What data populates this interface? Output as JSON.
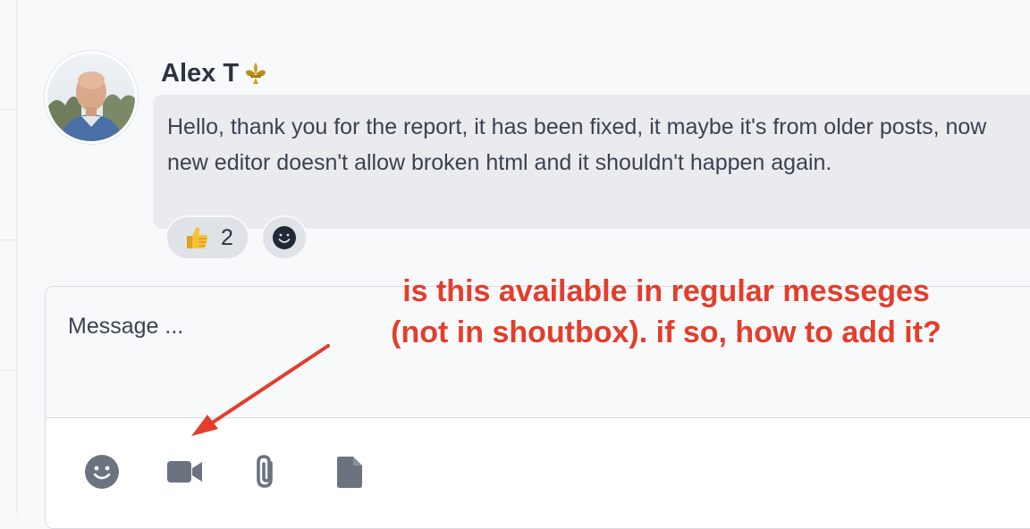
{
  "message": {
    "author": "Alex T",
    "author_badge_icon": "fleur-de-lis-icon",
    "text": "Hello, thank you for the report, it has been fixed, it maybe it's from older posts, now new editor doesn't allow broken html and it shouldn't happen again.",
    "reactions": [
      {
        "icon": "thumbs-up-icon",
        "count": "2"
      }
    ],
    "add_reaction_icon": "smiley-icon"
  },
  "composer": {
    "placeholder": "Message ...",
    "toolbar": [
      {
        "icon": "emoji-icon"
      },
      {
        "icon": "video-camera-icon"
      },
      {
        "icon": "paperclip-icon"
      },
      {
        "icon": "document-icon"
      }
    ]
  },
  "annotation": {
    "line1": "is this available in regular messeges",
    "line2": "(not in shoutbox). if so, how to add it?",
    "color": "#e43d2b"
  },
  "colors": {
    "bubble": "#e9ebef",
    "icon_gray": "#6b7280",
    "background": "#f8f9fb"
  }
}
